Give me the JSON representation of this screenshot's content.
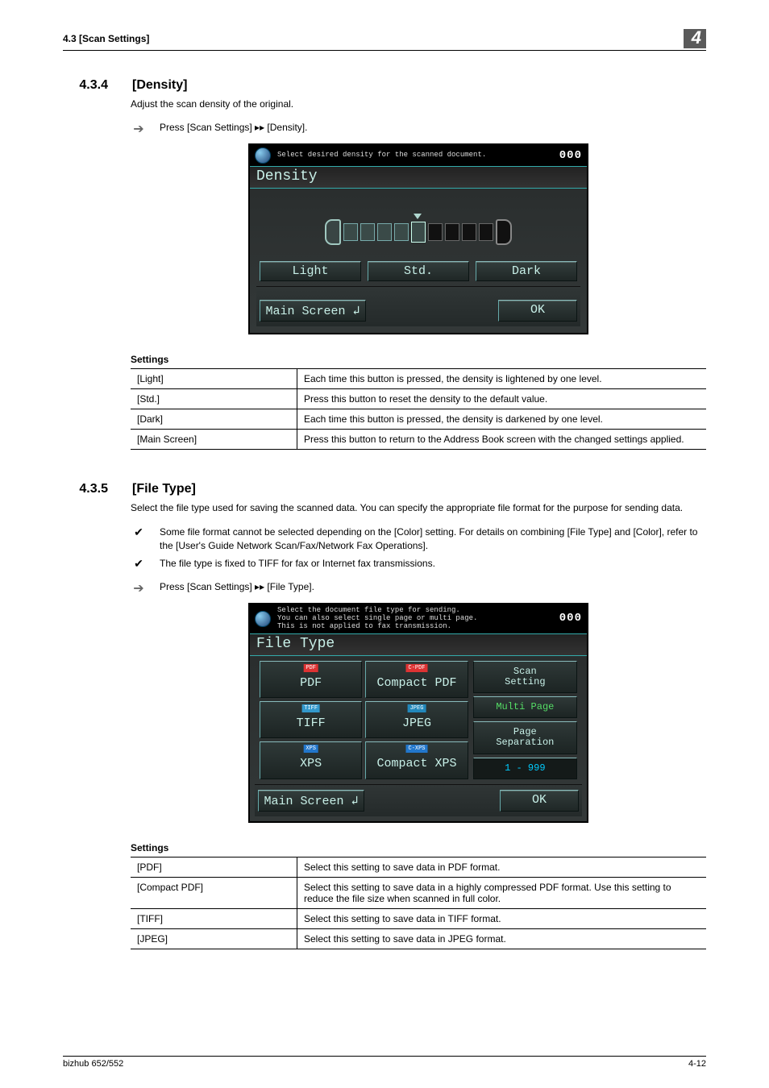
{
  "header": {
    "left": "4.3      [Scan Settings]",
    "right": "4"
  },
  "s434": {
    "num": "4.3.4",
    "title": "[Density]",
    "intro": "Adjust the scan density of the original.",
    "step": "Press [Scan Settings] ▸▸ [Density].",
    "shot": {
      "msg": "Select desired density for the scanned document.",
      "count": "000",
      "title": "Density",
      "light": "Light",
      "std": "Std.",
      "dark": "Dark",
      "main": "Main Screen ↲",
      "ok": "OK"
    },
    "table_title": "Settings",
    "rows": [
      {
        "k": "[Light]",
        "v": "Each time this button is pressed, the density is lightened by one level."
      },
      {
        "k": "[Std.]",
        "v": "Press this button to reset the density to the default value."
      },
      {
        "k": "[Dark]",
        "v": "Each time this button is pressed, the density is darkened by one level."
      },
      {
        "k": "[Main Screen]",
        "v": "Press this button to return to the Address Book screen with the changed settings applied."
      }
    ]
  },
  "s435": {
    "num": "4.3.5",
    "title": "[File Type]",
    "intro": "Select the file type used for saving the scanned data. You can specify the appropriate file format for the purpose for sending data.",
    "note1": "Some file format cannot be selected depending on the [Color] setting. For details on combining [File Type] and [Color], refer to the [User's Guide Network Scan/Fax/Network Fax Operations].",
    "note2": "The file type is fixed to TIFF for fax or Internet fax transmissions.",
    "step": "Press [Scan Settings] ▸▸ [File Type].",
    "shot": {
      "msg": "Select the document file type for sending.\nYou can also select single page or multi page.\nThis is not applied to fax transmission.",
      "count": "000",
      "title": "File Type",
      "pdf": "PDF",
      "cpdf": "Compact PDF",
      "tiff": "TIFF",
      "jpeg": "JPEG",
      "xps": "XPS",
      "cxps": "Compact XPS",
      "scanset": "Scan\nSetting",
      "multi": "Multi Page",
      "pagesep": "Page\nSeparation",
      "range": "1   -   999",
      "main": "Main Screen ↲",
      "ok": "OK"
    },
    "table_title": "Settings",
    "rows": [
      {
        "k": "[PDF]",
        "v": "Select this setting to save data in PDF format."
      },
      {
        "k": "[Compact PDF]",
        "v": "Select this setting to save data in a highly compressed PDF format. Use this setting to reduce the file size when scanned in full color."
      },
      {
        "k": "[TIFF]",
        "v": "Select this setting to save data in TIFF format."
      },
      {
        "k": "[JPEG]",
        "v": "Select this setting to save data in JPEG format."
      }
    ]
  },
  "footer": {
    "left": "bizhub 652/552",
    "right": "4-12"
  }
}
